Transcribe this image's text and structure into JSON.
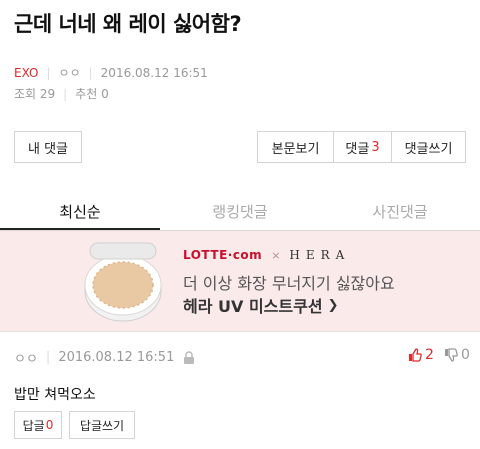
{
  "post": {
    "title": "근데 너네 왜 레이 싫어함?",
    "category": "EXO",
    "author": "ㅇㅇ",
    "date": "2016.08.12 16:51",
    "views_label": "조회 29",
    "likes_label": "추천 0"
  },
  "actions": {
    "my_comments": "내 댓글",
    "view_post": "본문보기",
    "comments_label": "댓글",
    "comments_count": "3",
    "write_comment": "댓글쓰기"
  },
  "tabs": [
    {
      "label": "최신순",
      "active": true
    },
    {
      "label": "랭킹댓글",
      "active": false
    },
    {
      "label": "사진댓글",
      "active": false
    }
  ],
  "ad": {
    "brand_lotte": "LOTTE·com",
    "brand_x": "×",
    "brand_hera": "HERA",
    "line1": "더 이상 화장 무너지기 싫잖아요",
    "line2": "헤라 UV 미스트쿠션",
    "arrow": "❯"
  },
  "comment": {
    "author": "ㅇㅇ",
    "date": "2016.08.12 16:51",
    "up_count": "2",
    "down_count": "0",
    "body": "밥만 쳐먹오소",
    "reply_label": "답글",
    "reply_count": "0",
    "write_reply": "답글쓰기"
  },
  "colors": {
    "accent": "#e0282d",
    "ad_bg": "#fbeaea"
  },
  "icons": [
    "lock-icon",
    "thumbs-up-icon",
    "thumbs-down-icon",
    "chevron-right-icon"
  ]
}
